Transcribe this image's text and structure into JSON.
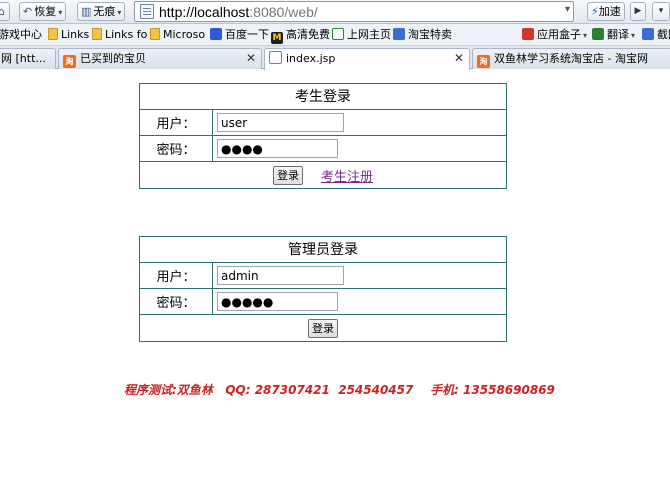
{
  "toolbar": {
    "restore_label": "恢复",
    "no_trace_label": "无痕",
    "url_host": "http://localhost",
    "url_rest": ":8080/web/",
    "speed_label": "加速"
  },
  "favorites": [
    {
      "label": "游戏中心",
      "icon": "game-icon"
    },
    {
      "label": "Links",
      "icon": "folder-icon"
    },
    {
      "label": "Links fo",
      "icon": "folder-icon"
    },
    {
      "label": "Microso",
      "icon": "folder-icon"
    },
    {
      "label": "百度一下",
      "icon": "baidu-paw-icon"
    },
    {
      "label": "高清免费",
      "icon": "m-icon"
    },
    {
      "label": "上网主页",
      "icon": "home-icon"
    },
    {
      "label": "淘宝特卖",
      "icon": "taobao-icon"
    },
    {
      "label": "应用盒子",
      "icon": "apps-icon"
    },
    {
      "label": "翻译",
      "icon": "translate-icon"
    },
    {
      "label": "截图",
      "icon": "screenshot-icon"
    }
  ],
  "tabs": [
    {
      "label": "网 [htt..."
    },
    {
      "label": "已买到的宝贝"
    },
    {
      "label": "index.jsp"
    },
    {
      "label": "双鱼林学习系统淘宝店 - 淘宝网"
    }
  ],
  "student_login": {
    "title": "考生登录",
    "user_label": "用户：",
    "user_value": "user",
    "pass_label": "密码：",
    "pass_value": "●●●●",
    "login_button": "登录",
    "register_link": "考生注册"
  },
  "admin_login": {
    "title": "管理员登录",
    "user_label": "用户：",
    "user_value": "admin",
    "pass_label": "密码：",
    "pass_value": "●●●●●",
    "login_button": "登录"
  },
  "footer_text": "程序测试:双鱼林   QQ: 287307421  254540457    手机: 13558690869",
  "colors": {
    "table_border": "#2e6f6f",
    "footer_red": "#cc2222",
    "link_purple": "#7b2b8f"
  }
}
